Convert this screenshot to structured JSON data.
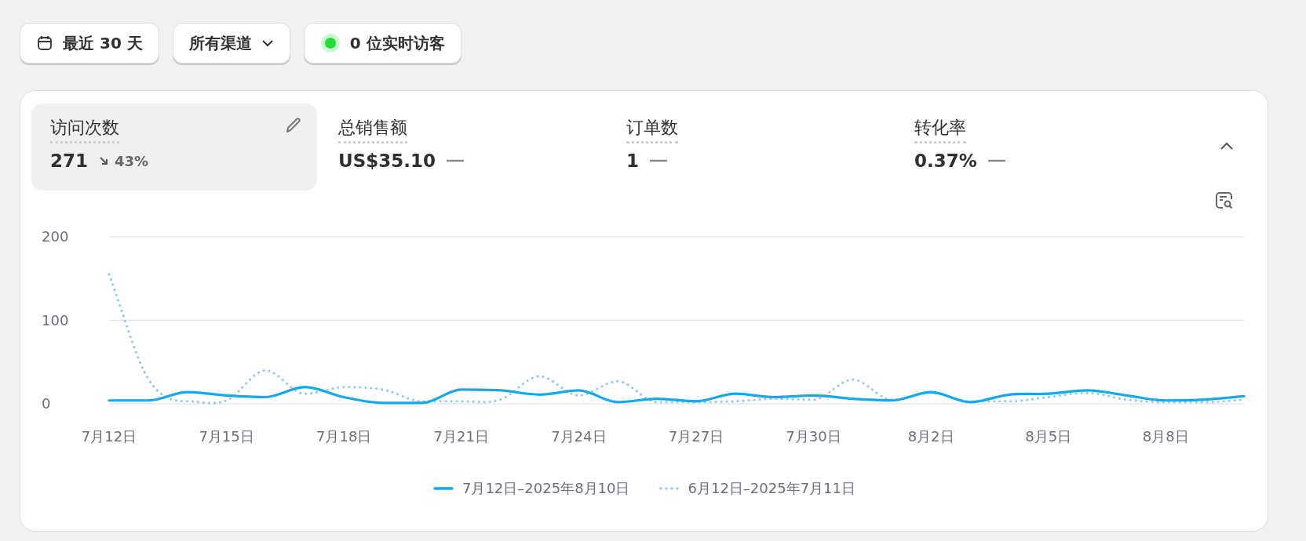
{
  "filters": [
    {
      "kind": "date",
      "label": "最近 30 天"
    },
    {
      "kind": "dropdown",
      "label": "所有渠道"
    },
    {
      "kind": "live",
      "label": "0 位实时访客",
      "color": "#22dd33"
    }
  ],
  "metrics": [
    {
      "label": "访问次数",
      "value": "271",
      "selected": true,
      "change": {
        "kind": "down",
        "text": "43%"
      }
    },
    {
      "label": "总销售额",
      "value": "US$35.10",
      "selected": false,
      "change": {
        "kind": "none"
      }
    },
    {
      "label": "订单数",
      "value": "1",
      "selected": false,
      "change": {
        "kind": "none"
      }
    },
    {
      "label": "转化率",
      "value": "0.37%",
      "selected": false,
      "change": {
        "kind": "none"
      }
    }
  ],
  "chart": {
    "chart_data": {
      "type": "line",
      "categories": [
        "7月12日",
        null,
        null,
        "7月15日",
        null,
        null,
        "7月18日",
        null,
        null,
        "7月21日",
        null,
        null,
        "7月24日",
        null,
        null,
        "7月27日",
        null,
        null,
        "7月30日",
        null,
        null,
        "8月2日",
        null,
        null,
        "8月5日",
        null,
        null,
        "8月8日",
        null,
        null
      ],
      "series": [
        {
          "name": "7月12日–2025年8月10日",
          "color": "#13a9ef",
          "line_style": "solid",
          "values": [
            4,
            4,
            14,
            10,
            8,
            20,
            8,
            1,
            1,
            17,
            16,
            11,
            16,
            2,
            6,
            3,
            12,
            8,
            10,
            6,
            4,
            14,
            2,
            11,
            12,
            16,
            10,
            4,
            5,
            9
          ]
        },
        {
          "name": "6月12日–2025年7月11日",
          "color": "#8ccbec",
          "line_style": "dotted",
          "values": [
            155,
            30,
            3,
            4,
            40,
            12,
            20,
            17,
            3,
            3,
            5,
            33,
            10,
            27,
            2,
            2,
            3,
            6,
            5,
            29,
            5,
            13,
            3,
            3,
            8,
            13,
            5,
            2,
            2,
            5
          ]
        }
      ],
      "ylim": [
        0,
        200
      ],
      "yticks": [
        0,
        100,
        200
      ]
    }
  }
}
